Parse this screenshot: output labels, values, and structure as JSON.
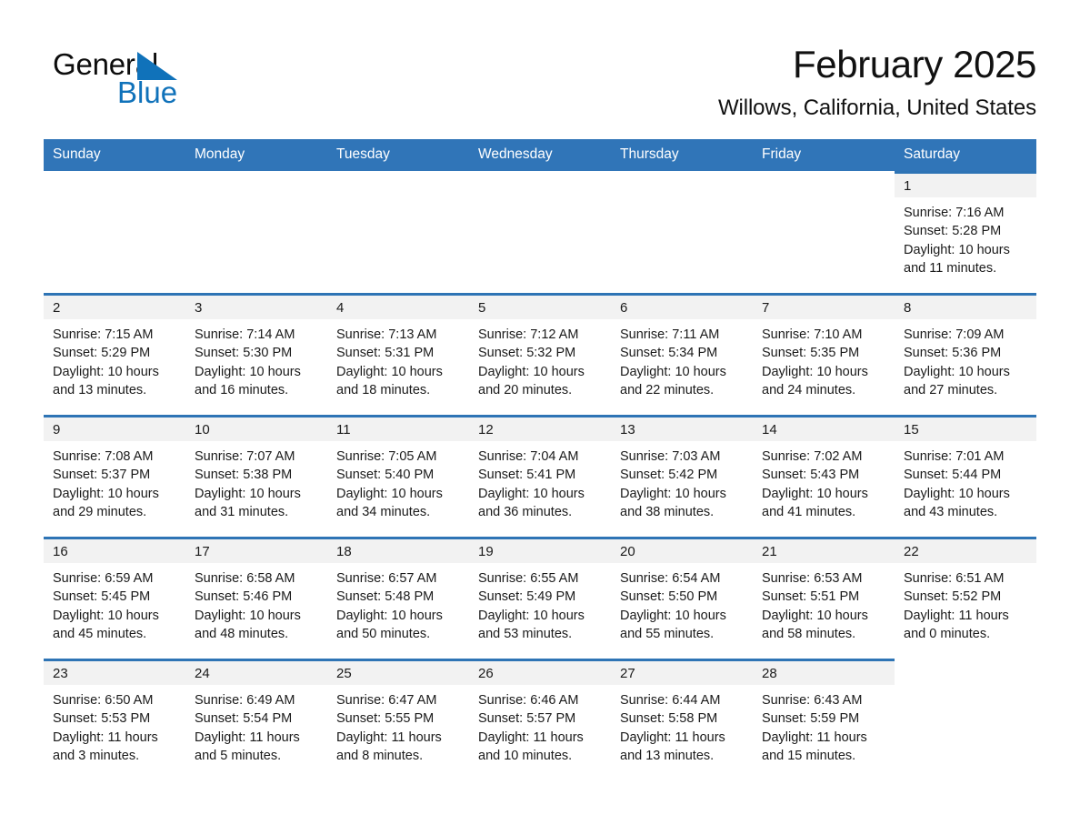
{
  "brand": {
    "name_part1": "General",
    "name_part2": "Blue",
    "accent_color": "#1072ba"
  },
  "header": {
    "title": "February 2025",
    "subtitle": "Willows, California, United States"
  },
  "theme": {
    "header_blue": "#3075b8",
    "rule_blue": "#2e74b5",
    "daystrip_gray": "#f2f2f2"
  },
  "weekdays": [
    "Sunday",
    "Monday",
    "Tuesday",
    "Wednesday",
    "Thursday",
    "Friday",
    "Saturday"
  ],
  "weeks": [
    [
      {
        "blank": true
      },
      {
        "blank": true
      },
      {
        "blank": true
      },
      {
        "blank": true
      },
      {
        "blank": true
      },
      {
        "blank": true
      },
      {
        "day": "1",
        "sunrise": "Sunrise: 7:16 AM",
        "sunset": "Sunset: 5:28 PM",
        "daylight1": "Daylight: 10 hours",
        "daylight2": "and 11 minutes."
      }
    ],
    [
      {
        "day": "2",
        "sunrise": "Sunrise: 7:15 AM",
        "sunset": "Sunset: 5:29 PM",
        "daylight1": "Daylight: 10 hours",
        "daylight2": "and 13 minutes."
      },
      {
        "day": "3",
        "sunrise": "Sunrise: 7:14 AM",
        "sunset": "Sunset: 5:30 PM",
        "daylight1": "Daylight: 10 hours",
        "daylight2": "and 16 minutes."
      },
      {
        "day": "4",
        "sunrise": "Sunrise: 7:13 AM",
        "sunset": "Sunset: 5:31 PM",
        "daylight1": "Daylight: 10 hours",
        "daylight2": "and 18 minutes."
      },
      {
        "day": "5",
        "sunrise": "Sunrise: 7:12 AM",
        "sunset": "Sunset: 5:32 PM",
        "daylight1": "Daylight: 10 hours",
        "daylight2": "and 20 minutes."
      },
      {
        "day": "6",
        "sunrise": "Sunrise: 7:11 AM",
        "sunset": "Sunset: 5:34 PM",
        "daylight1": "Daylight: 10 hours",
        "daylight2": "and 22 minutes."
      },
      {
        "day": "7",
        "sunrise": "Sunrise: 7:10 AM",
        "sunset": "Sunset: 5:35 PM",
        "daylight1": "Daylight: 10 hours",
        "daylight2": "and 24 minutes."
      },
      {
        "day": "8",
        "sunrise": "Sunrise: 7:09 AM",
        "sunset": "Sunset: 5:36 PM",
        "daylight1": "Daylight: 10 hours",
        "daylight2": "and 27 minutes."
      }
    ],
    [
      {
        "day": "9",
        "sunrise": "Sunrise: 7:08 AM",
        "sunset": "Sunset: 5:37 PM",
        "daylight1": "Daylight: 10 hours",
        "daylight2": "and 29 minutes."
      },
      {
        "day": "10",
        "sunrise": "Sunrise: 7:07 AM",
        "sunset": "Sunset: 5:38 PM",
        "daylight1": "Daylight: 10 hours",
        "daylight2": "and 31 minutes."
      },
      {
        "day": "11",
        "sunrise": "Sunrise: 7:05 AM",
        "sunset": "Sunset: 5:40 PM",
        "daylight1": "Daylight: 10 hours",
        "daylight2": "and 34 minutes."
      },
      {
        "day": "12",
        "sunrise": "Sunrise: 7:04 AM",
        "sunset": "Sunset: 5:41 PM",
        "daylight1": "Daylight: 10 hours",
        "daylight2": "and 36 minutes."
      },
      {
        "day": "13",
        "sunrise": "Sunrise: 7:03 AM",
        "sunset": "Sunset: 5:42 PM",
        "daylight1": "Daylight: 10 hours",
        "daylight2": "and 38 minutes."
      },
      {
        "day": "14",
        "sunrise": "Sunrise: 7:02 AM",
        "sunset": "Sunset: 5:43 PM",
        "daylight1": "Daylight: 10 hours",
        "daylight2": "and 41 minutes."
      },
      {
        "day": "15",
        "sunrise": "Sunrise: 7:01 AM",
        "sunset": "Sunset: 5:44 PM",
        "daylight1": "Daylight: 10 hours",
        "daylight2": "and 43 minutes."
      }
    ],
    [
      {
        "day": "16",
        "sunrise": "Sunrise: 6:59 AM",
        "sunset": "Sunset: 5:45 PM",
        "daylight1": "Daylight: 10 hours",
        "daylight2": "and 45 minutes."
      },
      {
        "day": "17",
        "sunrise": "Sunrise: 6:58 AM",
        "sunset": "Sunset: 5:46 PM",
        "daylight1": "Daylight: 10 hours",
        "daylight2": "and 48 minutes."
      },
      {
        "day": "18",
        "sunrise": "Sunrise: 6:57 AM",
        "sunset": "Sunset: 5:48 PM",
        "daylight1": "Daylight: 10 hours",
        "daylight2": "and 50 minutes."
      },
      {
        "day": "19",
        "sunrise": "Sunrise: 6:55 AM",
        "sunset": "Sunset: 5:49 PM",
        "daylight1": "Daylight: 10 hours",
        "daylight2": "and 53 minutes."
      },
      {
        "day": "20",
        "sunrise": "Sunrise: 6:54 AM",
        "sunset": "Sunset: 5:50 PM",
        "daylight1": "Daylight: 10 hours",
        "daylight2": "and 55 minutes."
      },
      {
        "day": "21",
        "sunrise": "Sunrise: 6:53 AM",
        "sunset": "Sunset: 5:51 PM",
        "daylight1": "Daylight: 10 hours",
        "daylight2": "and 58 minutes."
      },
      {
        "day": "22",
        "sunrise": "Sunrise: 6:51 AM",
        "sunset": "Sunset: 5:52 PM",
        "daylight1": "Daylight: 11 hours",
        "daylight2": "and 0 minutes."
      }
    ],
    [
      {
        "day": "23",
        "sunrise": "Sunrise: 6:50 AM",
        "sunset": "Sunset: 5:53 PM",
        "daylight1": "Daylight: 11 hours",
        "daylight2": "and 3 minutes."
      },
      {
        "day": "24",
        "sunrise": "Sunrise: 6:49 AM",
        "sunset": "Sunset: 5:54 PM",
        "daylight1": "Daylight: 11 hours",
        "daylight2": "and 5 minutes."
      },
      {
        "day": "25",
        "sunrise": "Sunrise: 6:47 AM",
        "sunset": "Sunset: 5:55 PM",
        "daylight1": "Daylight: 11 hours",
        "daylight2": "and 8 minutes."
      },
      {
        "day": "26",
        "sunrise": "Sunrise: 6:46 AM",
        "sunset": "Sunset: 5:57 PM",
        "daylight1": "Daylight: 11 hours",
        "daylight2": "and 10 minutes."
      },
      {
        "day": "27",
        "sunrise": "Sunrise: 6:44 AM",
        "sunset": "Sunset: 5:58 PM",
        "daylight1": "Daylight: 11 hours",
        "daylight2": "and 13 minutes."
      },
      {
        "day": "28",
        "sunrise": "Sunrise: 6:43 AM",
        "sunset": "Sunset: 5:59 PM",
        "daylight1": "Daylight: 11 hours",
        "daylight2": "and 15 minutes."
      },
      {
        "blank": true
      }
    ]
  ]
}
